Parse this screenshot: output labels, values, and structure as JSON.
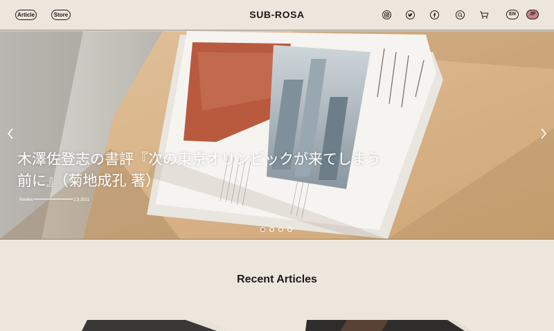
{
  "header": {
    "nav": [
      {
        "label": "Article"
      },
      {
        "label": "Store"
      }
    ],
    "logo": "SUB-ROSA",
    "icons": [
      "instagram-icon",
      "twitter-icon",
      "facebook-icon",
      "search-icon",
      "cart-icon"
    ],
    "languages": [
      {
        "label": "EN",
        "active": false
      },
      {
        "label": "JP",
        "active": true
      }
    ]
  },
  "hero": {
    "title": "木澤佐登志の書評『次の東京オリンピックが来てしまう前に』（菊地成孔 著）",
    "category": "Review",
    "date": "2.3.2021",
    "slides": 4,
    "active_slide": 1
  },
  "recent": {
    "title": "Recent Articles"
  },
  "colors": {
    "background": "#ede6dc",
    "accent": "#c9828d",
    "text": "#1a1a1a"
  }
}
